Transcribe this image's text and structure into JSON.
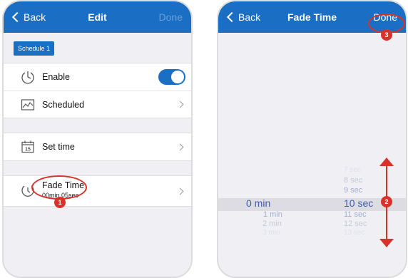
{
  "left": {
    "nav": {
      "back": "Back",
      "title": "Edit",
      "done": "Done"
    },
    "chip": "Schedule 1",
    "rows": {
      "enable": "Enable",
      "scheduled": "Scheduled",
      "set_time": "Set time",
      "fade_time": "Fade Time",
      "fade_value": "00min 05sec"
    },
    "calendar_day": "15"
  },
  "right": {
    "nav": {
      "back": "Back",
      "title": "Fade Time",
      "done": "Done"
    },
    "minutes": {
      "selected": "0 min",
      "below": [
        "1 min",
        "2 min",
        "3 min"
      ]
    },
    "seconds": {
      "above": [
        "7 sec",
        "8 sec",
        "9 sec"
      ],
      "selected": "10 sec",
      "below": [
        "11 sec",
        "12 sec",
        "13 sec"
      ]
    }
  },
  "callouts": {
    "one": "1",
    "two": "2",
    "three": "3"
  },
  "colors": {
    "accent": "#1a6fc4",
    "callout": "#d9322b"
  },
  "icons": {
    "enable": "power-clock-icon",
    "scheduled": "chart-icon",
    "set_time": "calendar-icon",
    "fade_time": "clock-icon"
  }
}
